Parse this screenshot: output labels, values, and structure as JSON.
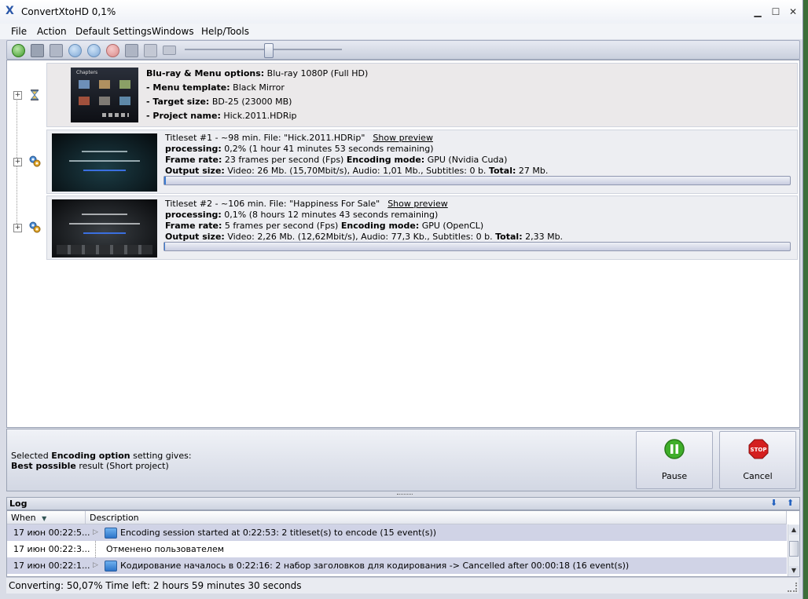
{
  "window": {
    "title": "ConvertXtoHD 0,1%",
    "app_logo": "X",
    "minimize_glyph": "▁",
    "maximize_glyph": "☐",
    "close_glyph": "✕"
  },
  "menu": {
    "items": [
      "File",
      "Action",
      "Default Settings",
      "Windows",
      "Help/Tools"
    ]
  },
  "toolbar": {
    "icons": [
      "add-icon",
      "save-icon",
      "grid-icon",
      "download-icon",
      "upload-icon",
      "delete-icon",
      "wrench-icon",
      "document-icon",
      "monitor-icon"
    ],
    "slider_level": 0.5
  },
  "project": {
    "line1_label": "Blu-ray & Menu options:",
    "line1_value": " Blu-ray 1080P (Full HD)",
    "line2_label": "- Menu template:",
    "line2_value": " Black Mirror",
    "line3_label": "- Target size:",
    "line3_value": " BD-25 (23000 MB)",
    "line4_label": "- Project name:",
    "line4_value": " Hick.2011.HDRip",
    "thumb_caption": "Chapters"
  },
  "titlesets": [
    {
      "header": "Titleset #1 - ~98 min. File: \"Hick.2011.HDRip\"",
      "preview_link": "Show preview",
      "processing_label": "processing:",
      "processing_value": " 0,2% (1 hour 41 minutes 53 seconds  remaining)",
      "frame_label": "Frame rate:",
      "frame_value": " 23 frames per second (Fps) ",
      "encoding_label": "Encoding mode:",
      "encoding_value": " GPU (Nvidia Cuda)",
      "output_label": "Output size:",
      "output_value": " Video: 26 Mb. (15,70Mbit/s), Audio: 1,01 Mb., Subtitles: 0    b. ",
      "total_label": "Total:",
      "total_value": " 27 Mb.",
      "progress": 0.002
    },
    {
      "header": "Titleset #2 - ~106 min. File: \"Happiness For Sale\"",
      "preview_link": "Show preview",
      "processing_label": "processing:",
      "processing_value": " 0,1% (8 hours 12 minutes 43 seconds  remaining)",
      "frame_label": "Frame rate:",
      "frame_value": " 5 frames per second (Fps) ",
      "encoding_label": "Encoding mode:",
      "encoding_value": " GPU (OpenCL)",
      "output_label": "Output size:",
      "output_value": " Video: 2,26 Mb. (12,62Mbit/s), Audio: 77,3 Kb., Subtitles: 0    b. ",
      "total_label": "Total:",
      "total_value": " 2,33 Mb.",
      "progress": 0.001
    }
  ],
  "encoding_info": {
    "line1_prefix": "Selected ",
    "line1_bold": "Encoding option",
    "line1_suffix": " setting gives:",
    "line2_bold": "Best possible",
    "line2_suffix": " result (Short project)"
  },
  "buttons": {
    "pause_label": "Pause",
    "cancel_label": "Cancel",
    "stop_sign_text": "STOP"
  },
  "log": {
    "title": "Log",
    "col_when": "When",
    "col_description": "Description",
    "rows": [
      {
        "when": "17 июн 00:22:5...",
        "description": "Encoding session started at 0:22:53: 2 titleset(s) to encode (15 event(s))"
      },
      {
        "when": "17 июн 00:22:3...",
        "description": "Отменено пользователем"
      },
      {
        "when": "17 июн 00:22:1...",
        "description": "Кодирование началось в 0:22:16: 2 набор заголовков для кодирования -> Cancelled after 00:00:18 (16 event(s))"
      }
    ]
  },
  "status": {
    "text": "Converting: 50,07% Time left: 2 hours 59 minutes 30 seconds"
  },
  "colors": {
    "accent_blue": "#2c74c9",
    "stop_red": "#d42020",
    "pause_green": "#3fae2a",
    "row_alt": "#d0d3e6"
  }
}
